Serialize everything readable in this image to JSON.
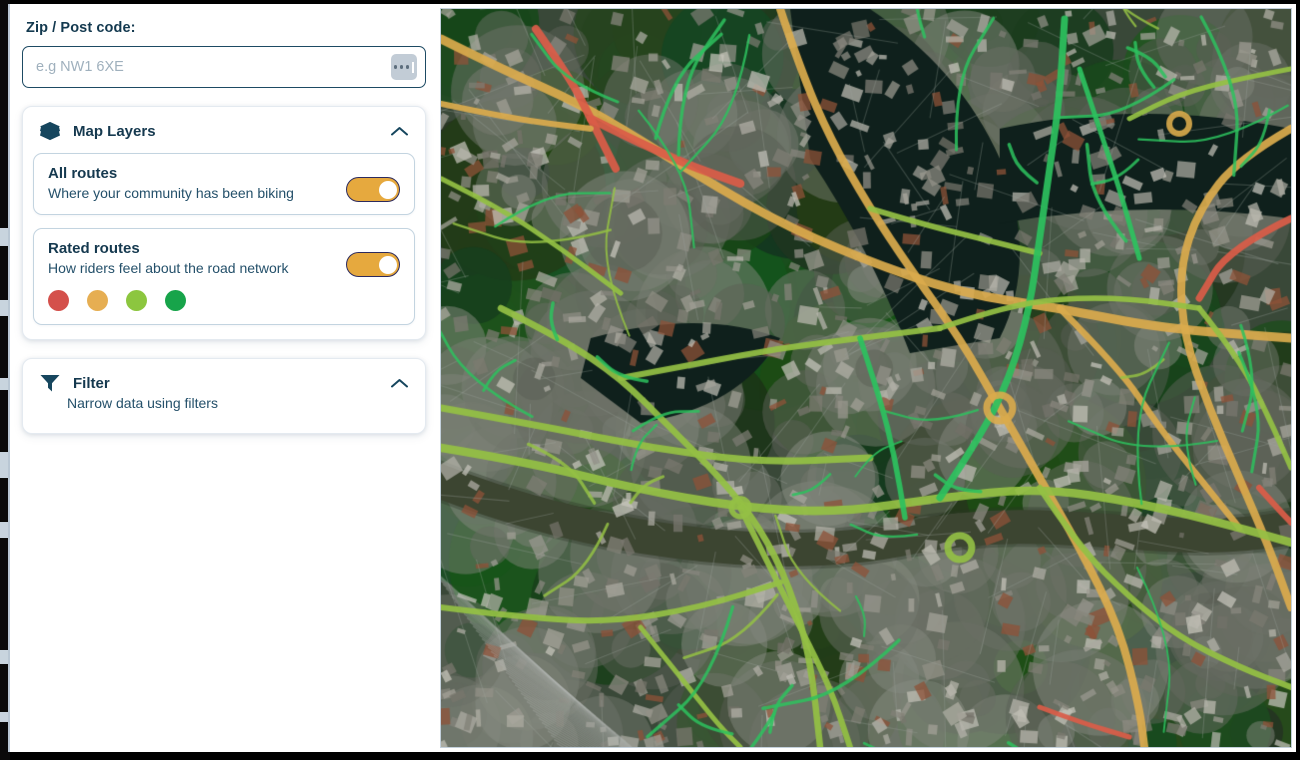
{
  "window": {
    "background_color": "#000000",
    "content_background": "#ffffff"
  },
  "sidebar": {
    "zip": {
      "label": "Zip / Post code:",
      "value": "",
      "placeholder": "e.g NW1 6XE",
      "action_icon": "ellipsis-icon"
    },
    "panels": [
      {
        "id": "map-layers",
        "icon": "layers-icon",
        "title": "Map Layers",
        "collapse_icon": "chevron-up-icon",
        "expanded": true,
        "options": [
          {
            "id": "all-routes",
            "title": "All routes",
            "subtitle": "Where your community has been biking",
            "toggle_on": true,
            "toggle_color": "#e6a93e"
          },
          {
            "id": "rated-routes",
            "title": "Rated routes",
            "subtitle": "How riders feel about the road network",
            "toggle_on": true,
            "toggle_color": "#e6a93e",
            "legend": [
              {
                "name": "rating-bad",
                "color": "#d4504b"
              },
              {
                "name": "rating-fair",
                "color": "#e6ae52"
              },
              {
                "name": "rating-good",
                "color": "#8cc63f"
              },
              {
                "name": "rating-great",
                "color": "#17a44a"
              }
            ]
          }
        ]
      },
      {
        "id": "filter",
        "icon": "funnel-icon",
        "title": "Filter",
        "collapse_icon": "chevron-up-icon",
        "expanded": true,
        "subtitle": "Narrow data using filters"
      }
    ]
  },
  "map": {
    "name": "satellite-cycling-map",
    "type": "satellite-imagery-with-route-overlay",
    "attribution": "",
    "route_colors": {
      "bad": "#e8604b",
      "fair": "#e8b44f",
      "good": "#9ccb47",
      "great": "#2ecc63"
    }
  }
}
